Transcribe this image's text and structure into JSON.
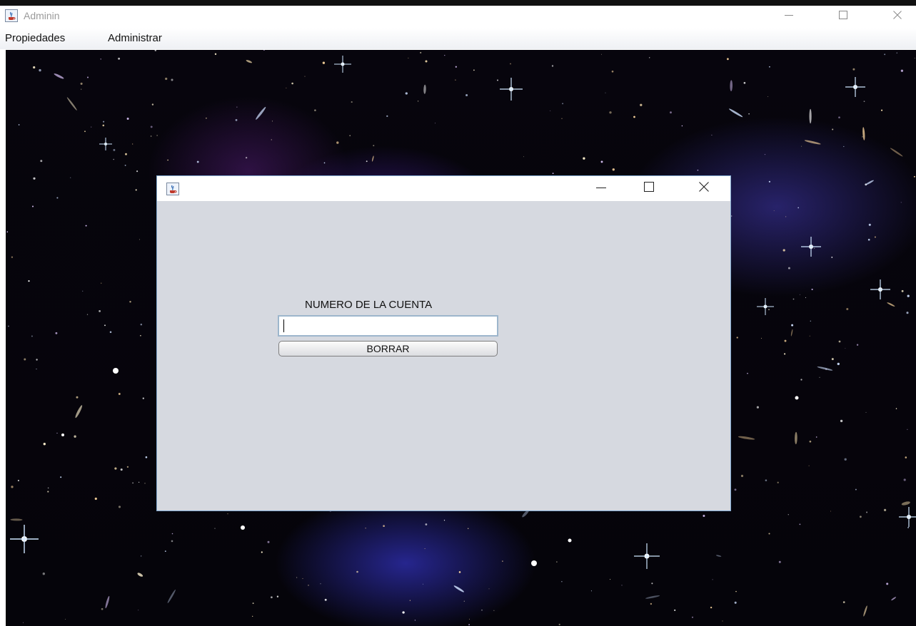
{
  "window": {
    "title": "Adminin",
    "app_icon": "java-cup-icon",
    "controls": [
      "minimize-icon",
      "maximize-icon",
      "close-icon"
    ]
  },
  "menubar": {
    "items": [
      {
        "label": "Propiedades"
      },
      {
        "label": "Administrar"
      }
    ]
  },
  "desktop": {
    "background": "galaxy-starfield"
  },
  "internal_frame": {
    "title": "",
    "icon": "java-cup-icon",
    "controls": [
      "minimize-icon",
      "maximize-icon",
      "close-icon"
    ],
    "account_label": "NUMERO DE LA CUENTA",
    "account_value": "",
    "delete_button_label": "BORRAR"
  },
  "colors": {
    "frame_background": "#d6d9e0",
    "frame_border": "#7fa6cf",
    "input_border": "#9db6cc"
  }
}
